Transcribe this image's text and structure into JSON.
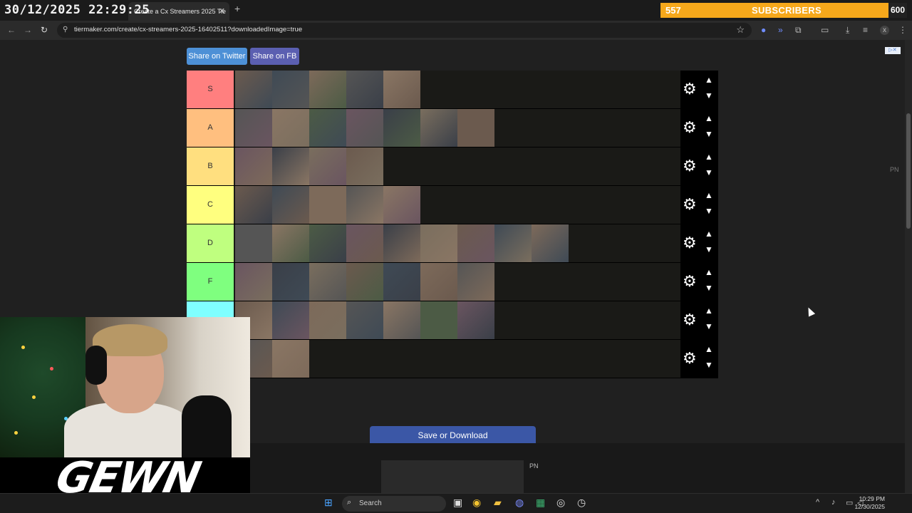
{
  "overlay": {
    "timestamp": "30/12/2025 22:29:25",
    "subscribers": {
      "current": "557",
      "label": "SUBSCRIBERS",
      "goal": "600"
    },
    "streamer_logo": "GEWN"
  },
  "browser": {
    "tab_title": "Create a Cx Streamers 2025 Tie",
    "tab_close": "✕",
    "new_tab": "+",
    "url": "tiermaker.com/create/cx-streamers-2025-16402511?downloadedImage=true",
    "icons": [
      "back-icon",
      "forward-icon",
      "reload-icon",
      "site-info-icon",
      "star-icon",
      "extension-icon",
      "download-icon",
      "profile-icon",
      "menu-icon"
    ]
  },
  "page": {
    "share_twitter": "Share on Twitter",
    "share_fb": "Share on FB",
    "pn_right": "PN",
    "pn_bottom": "PN",
    "save_button": "Save or Download",
    "tiers": [
      {
        "label": "S",
        "color": "#ff7f7f",
        "count": 5
      },
      {
        "label": "A",
        "color": "#ffbf7f",
        "count": 7
      },
      {
        "label": "B",
        "color": "#ffdf7f",
        "count": 4
      },
      {
        "label": "C",
        "color": "#ffff7f",
        "count": 5
      },
      {
        "label": "D",
        "color": "#bfff7f",
        "count": 9
      },
      {
        "label": "F",
        "color": "#7fff7f",
        "count": 7
      },
      {
        "label": "",
        "color": "#7fffff",
        "count": 7
      },
      {
        "label": "",
        "color": "#7fbfff",
        "count": 2
      }
    ]
  },
  "taskbar": {
    "search_placeholder": "Search",
    "time": "10:29 PM",
    "date": "12/30/2025"
  }
}
